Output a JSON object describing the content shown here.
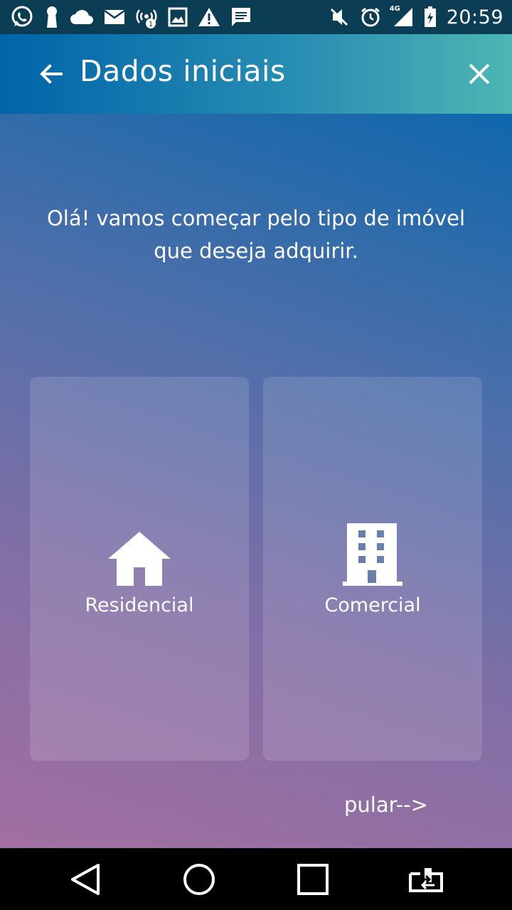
{
  "status_bar": {
    "left_icons": [
      "whatsapp-icon",
      "keyhole-icon",
      "cloud-icon",
      "mail-icon",
      "wifi-hotspot-icon",
      "image-icon",
      "warning-icon",
      "message-icon"
    ],
    "right_icons": [
      "mute-icon",
      "alarm-icon",
      "signal-4g-icon",
      "battery-charging-icon"
    ],
    "network_label": "4G",
    "time": "20:59"
  },
  "app_bar": {
    "title": "Dados iniciais",
    "back_icon": "arrow-left-icon",
    "close_icon": "close-icon"
  },
  "main": {
    "intro_line1": "Olá! vamos começar pelo tipo de imóvel",
    "intro_line2": "que deseja adquirir.",
    "options": [
      {
        "label": "Residencial",
        "icon": "house-icon"
      },
      {
        "label": "Comercial",
        "icon": "building-icon"
      }
    ],
    "skip_label": "pular-->"
  },
  "nav_bar": {
    "buttons": [
      "back-triangle-icon",
      "home-circle-icon",
      "recents-square-icon",
      "switch-app-icon"
    ]
  },
  "colors": {
    "status_bar_bg": "#0b3d55",
    "app_bar_gradient_start": "#0064a8",
    "app_bar_gradient_end": "#4cb6b3",
    "content_gradient_top": "#0f67ab",
    "content_gradient_bottom": "#a36fa1",
    "text": "#ffffff"
  }
}
